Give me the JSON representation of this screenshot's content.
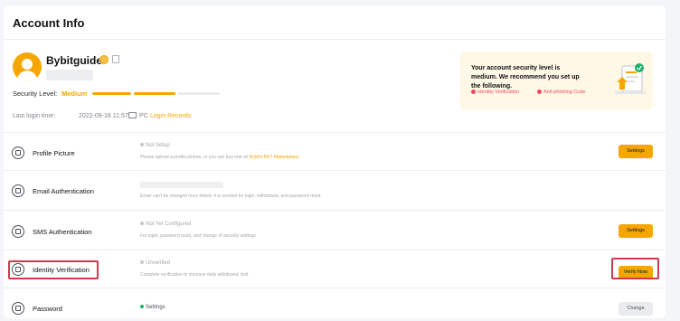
{
  "header": {
    "title": "Account Info"
  },
  "profile": {
    "username": "Bybitguide",
    "security_label": "Security Level:",
    "security_value": "Medium",
    "login_label": "Last login time:",
    "login_time": "2022-09-18 11:57",
    "login_separator": "/",
    "login_device": "PC",
    "login_link": "Login Records"
  },
  "banner": {
    "text": "Your account security level is medium. We recommend you set up the following.",
    "recommendations": [
      "Identity Verification",
      "Anti-phishing Code"
    ]
  },
  "rows": [
    {
      "title": "Profile Picture",
      "status": "Not Setup",
      "desc_prefix": "Please upload a profile picture, or you can buy one on",
      "desc_link": "Bybit's NFT Marketplace.",
      "button": "Settings"
    },
    {
      "title": "Email Authentication",
      "desc": "Email can't be changed once linked. It is needed for login, withdrawal, and password reset."
    },
    {
      "title": "SMS Authentication",
      "status": "Not Yet Configured",
      "desc": "For login, password reset, and change of security settings",
      "button": "Settings"
    },
    {
      "title": "Identity Verification",
      "status": "Unverified",
      "desc": "Complete verification to increase daily withdrawal limit",
      "button": "Verify Now"
    },
    {
      "title": "Password",
      "status": "Settings",
      "button": "Change"
    }
  ],
  "colors": {
    "accent": "#f6a600",
    "highlight": "#d0394e",
    "success": "#20b26c"
  }
}
